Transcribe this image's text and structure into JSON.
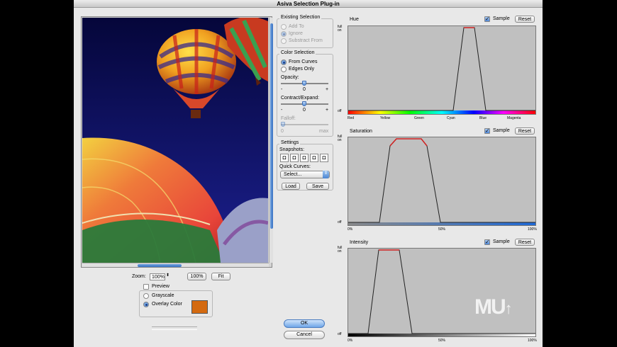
{
  "window": {
    "title": "Asiva Selection Plug-in"
  },
  "zoom": {
    "label": "Zoom:",
    "value": "100%",
    "preset_button": "100%",
    "fit_button": "Fit"
  },
  "preview": {
    "label": "Preview",
    "checked": false
  },
  "display_mode": {
    "grayscale": "Grayscale",
    "overlay": "Overlay Color",
    "selected": "overlay",
    "overlay_color": "#d46a10"
  },
  "existing_selection": {
    "title": "Existing Selection",
    "options": [
      "Add To",
      "Ignore",
      "Substract From"
    ],
    "selected": "Ignore",
    "disabled": true
  },
  "color_selection": {
    "title": "Color Selection",
    "options": [
      "From Curves",
      "Edges Only"
    ],
    "selected": "From Curves",
    "opacity": {
      "label": "Opacity:",
      "value": "0",
      "minus": "-",
      "plus": "+"
    },
    "contract": {
      "label": "Contract/Expand:",
      "value": "0",
      "minus": "-",
      "plus": "+"
    },
    "falloff": {
      "label": "Falloff:",
      "min": "0",
      "max": "max"
    }
  },
  "settings": {
    "title": "Settings",
    "snapshots_label": "Snapshots:",
    "quick_curves_label": "Quick Curves:",
    "quick_curves_value": "Select...",
    "load_button": "Load",
    "save_button": "Save"
  },
  "dialog_buttons": {
    "ok": "OK",
    "cancel": "Cancel"
  },
  "graphs": {
    "hue": {
      "title": "Hue",
      "sample_label": "Sample",
      "sample_checked": true,
      "reset_label": "Reset",
      "y_full": "full on",
      "y_off": "off",
      "ticks": [
        "Red",
        "Yellow",
        "Green",
        "Cyan",
        "Blue",
        "Magenta"
      ]
    },
    "saturation": {
      "title": "Saturation",
      "sample_label": "Sample",
      "sample_checked": true,
      "reset_label": "Reset",
      "y_full": "full on",
      "y_off": "off",
      "ticks": [
        "0%",
        "50%",
        "100%"
      ]
    },
    "intensity": {
      "title": "Intensity",
      "sample_label": "Sample",
      "sample_checked": true,
      "reset_label": "Reset",
      "y_full": "full on",
      "y_off": "off",
      "ticks": [
        "0%",
        "50%",
        "100%"
      ]
    }
  },
  "watermark": "MU"
}
